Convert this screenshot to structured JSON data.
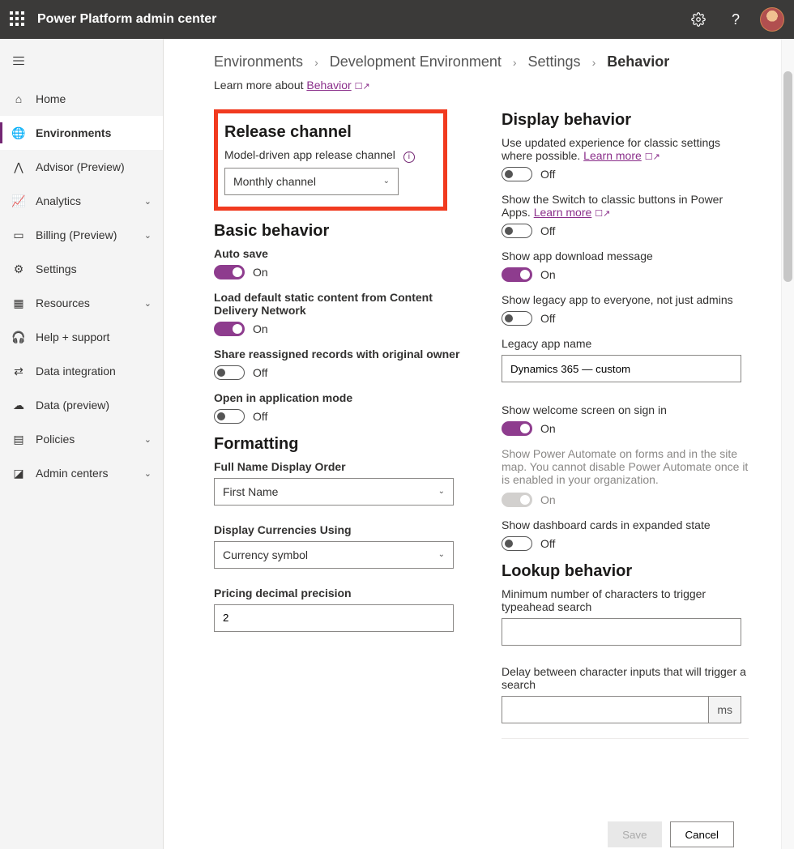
{
  "header": {
    "title": "Power Platform admin center"
  },
  "sidebar": {
    "items": [
      {
        "label": "Home",
        "icon": "home"
      },
      {
        "label": "Environments",
        "icon": "environments",
        "active": true
      },
      {
        "label": "Advisor (Preview)",
        "icon": "advisor"
      },
      {
        "label": "Analytics",
        "icon": "analytics",
        "expandable": true
      },
      {
        "label": "Billing (Preview)",
        "icon": "billing",
        "expandable": true
      },
      {
        "label": "Settings",
        "icon": "settings"
      },
      {
        "label": "Resources",
        "icon": "resources",
        "expandable": true
      },
      {
        "label": "Help + support",
        "icon": "help"
      },
      {
        "label": "Data integration",
        "icon": "dataint"
      },
      {
        "label": "Data (preview)",
        "icon": "datapv"
      },
      {
        "label": "Policies",
        "icon": "policies",
        "expandable": true
      },
      {
        "label": "Admin centers",
        "icon": "admin",
        "expandable": true
      }
    ]
  },
  "breadcrumbs": {
    "a": "Environments",
    "b": "Development Environment",
    "c": "Settings",
    "d": "Behavior"
  },
  "learn": {
    "prefix": "Learn more about ",
    "link": "Behavior"
  },
  "left": {
    "release": {
      "heading": "Release channel",
      "label": "Model-driven app release channel",
      "value": "Monthly channel"
    },
    "basic": {
      "heading": "Basic behavior",
      "autosave": {
        "label": "Auto save",
        "state": "On"
      },
      "cdn": {
        "label": "Load default static content from Content Delivery Network",
        "state": "On"
      },
      "share": {
        "label": "Share reassigned records with original owner",
        "state": "Off"
      },
      "appmode": {
        "label": "Open in application mode",
        "state": "Off"
      }
    },
    "formatting": {
      "heading": "Formatting",
      "fullname": {
        "label": "Full Name Display Order",
        "value": "First Name"
      },
      "currency": {
        "label": "Display Currencies Using",
        "value": "Currency symbol"
      },
      "precision": {
        "label": "Pricing decimal precision",
        "value": "2"
      }
    }
  },
  "right": {
    "display": {
      "heading": "Display behavior",
      "updated": {
        "text": "Use updated experience for classic settings where possible. ",
        "link": "Learn more",
        "state": "Off"
      },
      "switchclassic": {
        "text": "Show the Switch to classic buttons in Power Apps. ",
        "link": "Learn more",
        "state": "Off"
      },
      "download": {
        "label": "Show app download message",
        "state": "On"
      },
      "legacyall": {
        "label": "Show legacy app to everyone, not just admins",
        "state": "Off"
      },
      "legacyname": {
        "label": "Legacy app name",
        "value": "Dynamics 365 — custom"
      },
      "welcome": {
        "label": "Show welcome screen on sign in",
        "state": "On"
      },
      "automate": {
        "text": "Show Power Automate on forms and in the site map. You cannot disable Power Automate once it is enabled in your organization.",
        "state": "On"
      },
      "dashboard": {
        "label": "Show dashboard cards in expanded state",
        "state": "Off"
      }
    },
    "lookup": {
      "heading": "Lookup behavior",
      "minchars": {
        "label": "Minimum number of characters to trigger typeahead search",
        "value": ""
      },
      "delay": {
        "label": "Delay between character inputs that will trigger a search",
        "value": "",
        "suffix": "ms"
      }
    }
  },
  "footer": {
    "save": "Save",
    "cancel": "Cancel"
  }
}
